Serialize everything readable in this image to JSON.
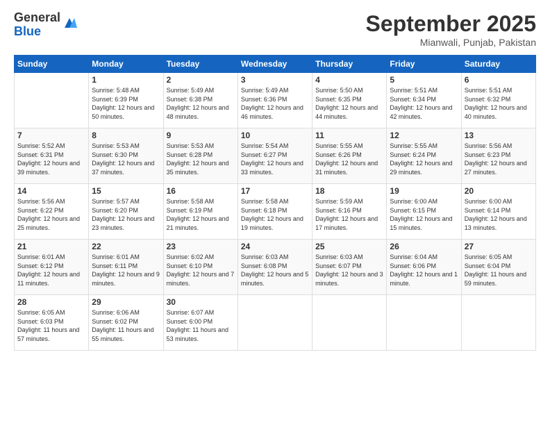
{
  "logo": {
    "general": "General",
    "blue": "Blue"
  },
  "header": {
    "month": "September 2025",
    "location": "Mianwali, Punjab, Pakistan"
  },
  "weekdays": [
    "Sunday",
    "Monday",
    "Tuesday",
    "Wednesday",
    "Thursday",
    "Friday",
    "Saturday"
  ],
  "weeks": [
    [
      {
        "day": "",
        "sunrise": "",
        "sunset": "",
        "daylight": ""
      },
      {
        "day": "1",
        "sunrise": "Sunrise: 5:48 AM",
        "sunset": "Sunset: 6:39 PM",
        "daylight": "Daylight: 12 hours and 50 minutes."
      },
      {
        "day": "2",
        "sunrise": "Sunrise: 5:49 AM",
        "sunset": "Sunset: 6:38 PM",
        "daylight": "Daylight: 12 hours and 48 minutes."
      },
      {
        "day": "3",
        "sunrise": "Sunrise: 5:49 AM",
        "sunset": "Sunset: 6:36 PM",
        "daylight": "Daylight: 12 hours and 46 minutes."
      },
      {
        "day": "4",
        "sunrise": "Sunrise: 5:50 AM",
        "sunset": "Sunset: 6:35 PM",
        "daylight": "Daylight: 12 hours and 44 minutes."
      },
      {
        "day": "5",
        "sunrise": "Sunrise: 5:51 AM",
        "sunset": "Sunset: 6:34 PM",
        "daylight": "Daylight: 12 hours and 42 minutes."
      },
      {
        "day": "6",
        "sunrise": "Sunrise: 5:51 AM",
        "sunset": "Sunset: 6:32 PM",
        "daylight": "Daylight: 12 hours and 40 minutes."
      }
    ],
    [
      {
        "day": "7",
        "sunrise": "Sunrise: 5:52 AM",
        "sunset": "Sunset: 6:31 PM",
        "daylight": "Daylight: 12 hours and 39 minutes."
      },
      {
        "day": "8",
        "sunrise": "Sunrise: 5:53 AM",
        "sunset": "Sunset: 6:30 PM",
        "daylight": "Daylight: 12 hours and 37 minutes."
      },
      {
        "day": "9",
        "sunrise": "Sunrise: 5:53 AM",
        "sunset": "Sunset: 6:28 PM",
        "daylight": "Daylight: 12 hours and 35 minutes."
      },
      {
        "day": "10",
        "sunrise": "Sunrise: 5:54 AM",
        "sunset": "Sunset: 6:27 PM",
        "daylight": "Daylight: 12 hours and 33 minutes."
      },
      {
        "day": "11",
        "sunrise": "Sunrise: 5:55 AM",
        "sunset": "Sunset: 6:26 PM",
        "daylight": "Daylight: 12 hours and 31 minutes."
      },
      {
        "day": "12",
        "sunrise": "Sunrise: 5:55 AM",
        "sunset": "Sunset: 6:24 PM",
        "daylight": "Daylight: 12 hours and 29 minutes."
      },
      {
        "day": "13",
        "sunrise": "Sunrise: 5:56 AM",
        "sunset": "Sunset: 6:23 PM",
        "daylight": "Daylight: 12 hours and 27 minutes."
      }
    ],
    [
      {
        "day": "14",
        "sunrise": "Sunrise: 5:56 AM",
        "sunset": "Sunset: 6:22 PM",
        "daylight": "Daylight: 12 hours and 25 minutes."
      },
      {
        "day": "15",
        "sunrise": "Sunrise: 5:57 AM",
        "sunset": "Sunset: 6:20 PM",
        "daylight": "Daylight: 12 hours and 23 minutes."
      },
      {
        "day": "16",
        "sunrise": "Sunrise: 5:58 AM",
        "sunset": "Sunset: 6:19 PM",
        "daylight": "Daylight: 12 hours and 21 minutes."
      },
      {
        "day": "17",
        "sunrise": "Sunrise: 5:58 AM",
        "sunset": "Sunset: 6:18 PM",
        "daylight": "Daylight: 12 hours and 19 minutes."
      },
      {
        "day": "18",
        "sunrise": "Sunrise: 5:59 AM",
        "sunset": "Sunset: 6:16 PM",
        "daylight": "Daylight: 12 hours and 17 minutes."
      },
      {
        "day": "19",
        "sunrise": "Sunrise: 6:00 AM",
        "sunset": "Sunset: 6:15 PM",
        "daylight": "Daylight: 12 hours and 15 minutes."
      },
      {
        "day": "20",
        "sunrise": "Sunrise: 6:00 AM",
        "sunset": "Sunset: 6:14 PM",
        "daylight": "Daylight: 12 hours and 13 minutes."
      }
    ],
    [
      {
        "day": "21",
        "sunrise": "Sunrise: 6:01 AM",
        "sunset": "Sunset: 6:12 PM",
        "daylight": "Daylight: 12 hours and 11 minutes."
      },
      {
        "day": "22",
        "sunrise": "Sunrise: 6:01 AM",
        "sunset": "Sunset: 6:11 PM",
        "daylight": "Daylight: 12 hours and 9 minutes."
      },
      {
        "day": "23",
        "sunrise": "Sunrise: 6:02 AM",
        "sunset": "Sunset: 6:10 PM",
        "daylight": "Daylight: 12 hours and 7 minutes."
      },
      {
        "day": "24",
        "sunrise": "Sunrise: 6:03 AM",
        "sunset": "Sunset: 6:08 PM",
        "daylight": "Daylight: 12 hours and 5 minutes."
      },
      {
        "day": "25",
        "sunrise": "Sunrise: 6:03 AM",
        "sunset": "Sunset: 6:07 PM",
        "daylight": "Daylight: 12 hours and 3 minutes."
      },
      {
        "day": "26",
        "sunrise": "Sunrise: 6:04 AM",
        "sunset": "Sunset: 6:06 PM",
        "daylight": "Daylight: 12 hours and 1 minute."
      },
      {
        "day": "27",
        "sunrise": "Sunrise: 6:05 AM",
        "sunset": "Sunset: 6:04 PM",
        "daylight": "Daylight: 11 hours and 59 minutes."
      }
    ],
    [
      {
        "day": "28",
        "sunrise": "Sunrise: 6:05 AM",
        "sunset": "Sunset: 6:03 PM",
        "daylight": "Daylight: 11 hours and 57 minutes."
      },
      {
        "day": "29",
        "sunrise": "Sunrise: 6:06 AM",
        "sunset": "Sunset: 6:02 PM",
        "daylight": "Daylight: 11 hours and 55 minutes."
      },
      {
        "day": "30",
        "sunrise": "Sunrise: 6:07 AM",
        "sunset": "Sunset: 6:00 PM",
        "daylight": "Daylight: 11 hours and 53 minutes."
      },
      {
        "day": "",
        "sunrise": "",
        "sunset": "",
        "daylight": ""
      },
      {
        "day": "",
        "sunrise": "",
        "sunset": "",
        "daylight": ""
      },
      {
        "day": "",
        "sunrise": "",
        "sunset": "",
        "daylight": ""
      },
      {
        "day": "",
        "sunrise": "",
        "sunset": "",
        "daylight": ""
      }
    ]
  ]
}
